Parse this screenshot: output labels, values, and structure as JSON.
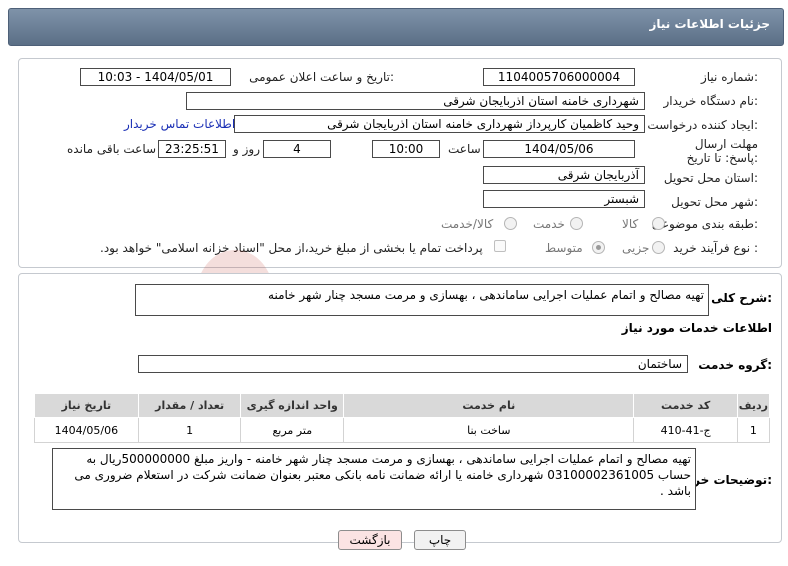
{
  "header": {
    "title": "جزئیات اطلاعات نیاز"
  },
  "form": {
    "need_number_label": "شماره نیاز:",
    "need_number": "1104005706000004",
    "announce_label": "تاریخ و ساعت اعلان عمومی:",
    "announce_value": "1404/05/01 - 10:03",
    "buyer_org_label": "نام دستگاه خریدار:",
    "buyer_org": "شهرداری خامنه استان اذربایجان شرقی",
    "requester_label": "ایجاد کننده درخواست:",
    "requester": "وحید کاظمیان کارپرداز شهرداری خامنه استان اذربایجان شرقی",
    "contact_link": "اطلاعات تماس خریدار",
    "deadline_label": "مهلت ارسال پاسخ: تا تاریخ:",
    "deadline_date": "1404/05/06",
    "time_label": "ساعت",
    "deadline_time": "10:00",
    "days_value": "4",
    "days_label": "روز و",
    "remaining_time": "23:25:51",
    "remaining_label": "ساعت باقی مانده",
    "province_label": "استان محل تحویل:",
    "province": "آذربایجان شرقی",
    "city_label": "شهر محل تحویل:",
    "city": "شبستر",
    "category_label": "طبقه بندی موضوعی:",
    "category_options": [
      "کالا",
      "خدمت",
      "کالا/خدمت"
    ],
    "process_label": "نوع فرآیند خرید :",
    "process_options": [
      "جزیی",
      "متوسط"
    ],
    "payment_note": "پرداخت تمام یا بخشی از مبلغ خرید،از محل \"اسناد خزانه اسلامی\" خواهد بود."
  },
  "summary": {
    "label": "شرح کلی نیاز:",
    "text": "تهیه مصالح و اتمام عملیات اجرایی ساماندهی ، بهسازی و مرمت مسجد چنار شهر خامنه"
  },
  "services": {
    "section_title": "اطلاعات خدمات مورد نیاز",
    "group_label": "گروه خدمت:",
    "group_value": "ساختمان",
    "columns": [
      "ردیف",
      "کد خدمت",
      "نام خدمت",
      "واحد اندازه گیری",
      "تعداد / مقدار",
      "تاریخ نیاز"
    ],
    "rows": [
      {
        "row": "1",
        "code": "ج-41-410",
        "name": "ساخت بنا",
        "unit": "متر مربع",
        "qty": "1",
        "date": "1404/05/06"
      }
    ]
  },
  "buyer_notes": {
    "label": "توضیحات خریدار:",
    "text": "تهیه مصالح و اتمام عملیات اجرایی ساماندهی ، بهسازی و مرمت مسجد چنار شهر خامنه - واریز مبلغ 500000000ریال به حساب 03100002361005 شهرداری خامنه یا ارائه ضمانت نامه بانکی معتبر بعنوان ضمانت شرکت در استعلام ضروری می باشد ."
  },
  "buttons": {
    "print": "چاپ",
    "back": "بازگشت"
  },
  "watermark": {
    "text": "AriaTender.net"
  },
  "colors": {
    "header": "#6b7f96",
    "link": "#1a2fb5",
    "back_button_bg": "#fbe3e3",
    "watermark": "#c0392b"
  }
}
